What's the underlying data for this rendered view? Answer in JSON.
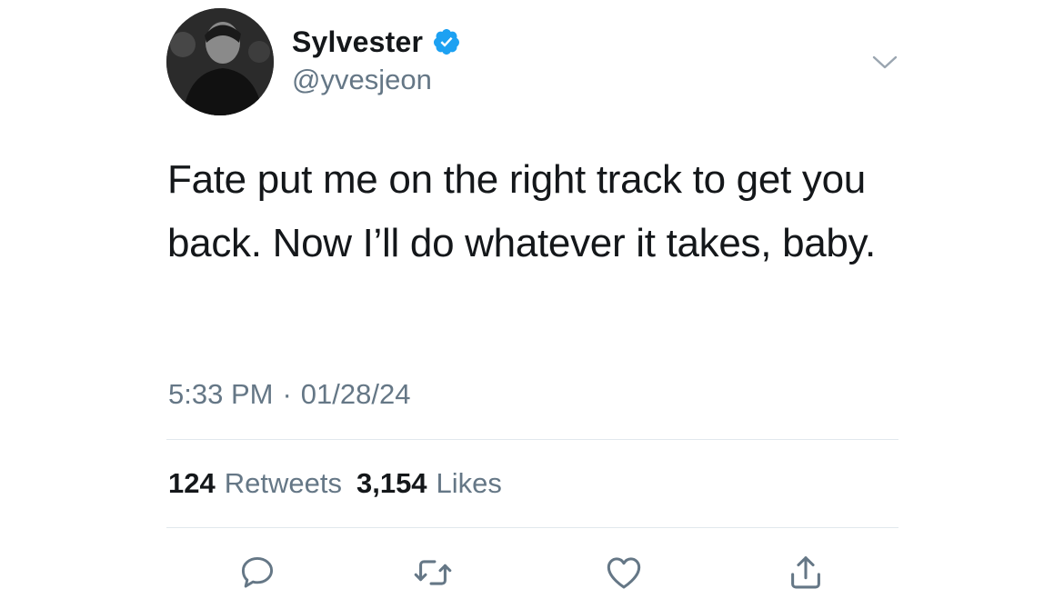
{
  "tweet": {
    "user": {
      "display_name": "Sylvester",
      "handle": "@yvesjeon",
      "verified": true,
      "avatar_icon": "profile-photo"
    },
    "text": "Fate put me on the right track to get you back. Now I’ll do whatever it takes, baby.",
    "time": "5:33 PM",
    "separator": "·",
    "date": "01/28/24",
    "stats": {
      "retweets_count": "124",
      "retweets_label": "Retweets",
      "likes_count": "3,154",
      "likes_label": "Likes"
    },
    "actions": [
      {
        "name": "reply",
        "icon": "speech-bubble-icon"
      },
      {
        "name": "retweet",
        "icon": "retweet-arrows-icon"
      },
      {
        "name": "like",
        "icon": "heart-icon"
      },
      {
        "name": "share",
        "icon": "share-upload-icon"
      }
    ],
    "menu_icon": "chevron-down-icon"
  },
  "colors": {
    "text_primary": "#14171a",
    "text_secondary": "#657786",
    "verified_blue": "#1da1f2",
    "divider": "#e1e8ed",
    "icon_gray": "#657786"
  }
}
